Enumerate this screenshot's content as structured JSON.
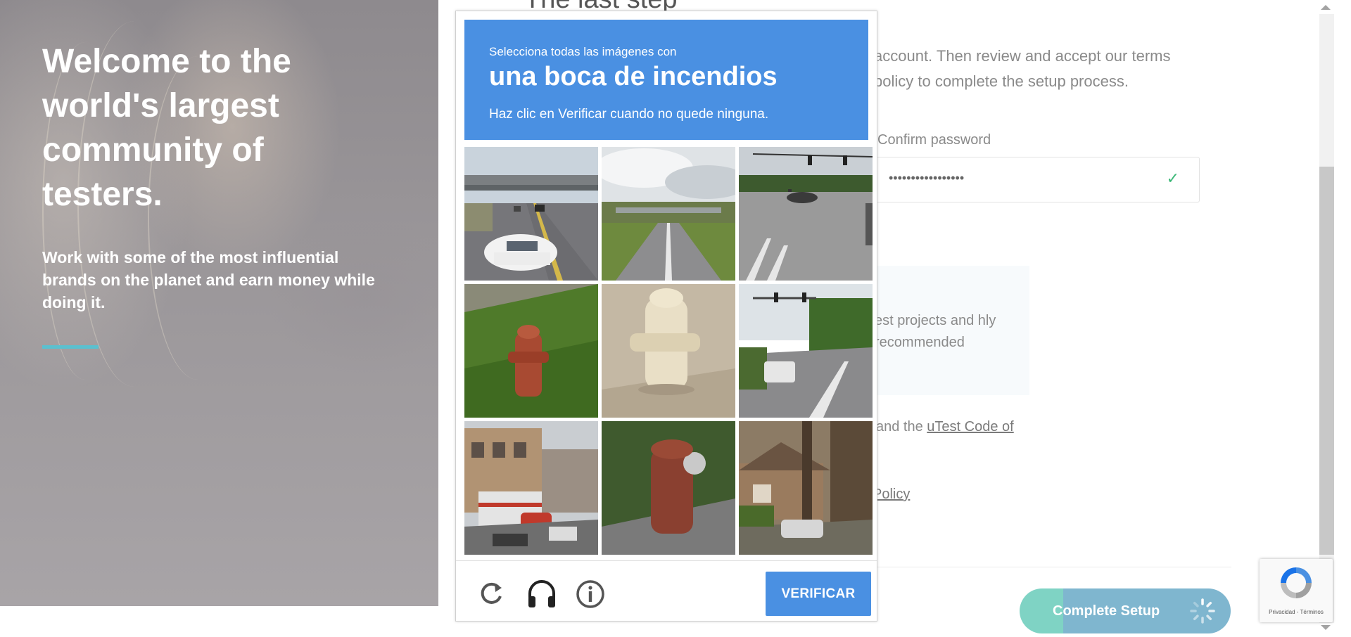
{
  "hero": {
    "heading": "Welcome to the world's largest community of testers.",
    "subtext": "Work with some of the most influential brands on the planet and earn money while doing it."
  },
  "form": {
    "title_partial": "The last step",
    "intro_partial": "account. Then review and accept our terms policy to complete the setup process.",
    "confirm_password_label": "Confirm password",
    "confirm_password_value": "•••••••••••••••••",
    "info_partial": "est projects and hly recommended",
    "terms_prefix": "and the ",
    "terms_link": "uTest Code of",
    "policy_link": "Policy",
    "complete_button": "Complete Setup"
  },
  "captcha": {
    "instruction_small": "Selecciona todas las imágenes con",
    "target": "una boca de incendios",
    "instruction_sub": "Haz clic en Verificar cuando no quede ninguna.",
    "verify_button": "VERIFICAR",
    "icons": [
      "reload-icon",
      "audio-challenge-icon",
      "help-info-icon"
    ],
    "tiles": [
      {
        "content": "highway with cars and overpass"
      },
      {
        "content": "road under overpass bridge"
      },
      {
        "content": "intersection with traffic lights"
      },
      {
        "content": "red fire hydrant on grass"
      },
      {
        "content": "white fire hydrant on sidewalk"
      },
      {
        "content": "street with traffic light and cars"
      },
      {
        "content": "city street with bus and buildings"
      },
      {
        "content": "close up of red hydrant"
      },
      {
        "content": "house with trees and parked car"
      }
    ]
  },
  "recaptcha_badge": {
    "terms": "Privacidad - Términos"
  },
  "colors": {
    "captcha_blue": "#4a90e2",
    "accent_teal": "#5bc0cf",
    "check_green": "#3cb878"
  }
}
